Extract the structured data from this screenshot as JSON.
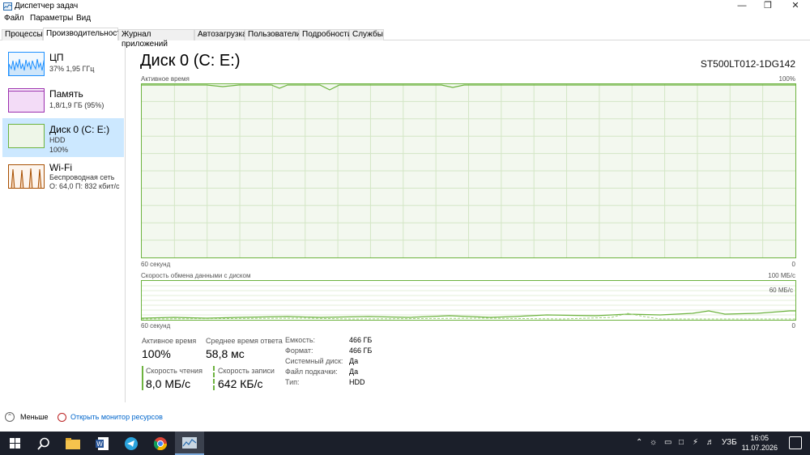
{
  "window": {
    "title": "Диспетчер задач"
  },
  "menu": [
    "Файл",
    "Параметры",
    "Вид"
  ],
  "tabs": [
    "Процессы",
    "Производительность",
    "Журнал приложений",
    "Автозагрузка",
    "Пользователи",
    "Подробности",
    "Службы"
  ],
  "active_tab": 1,
  "resources": [
    {
      "name": "ЦП",
      "line1": "37% 1,95 ГГц",
      "line2": ""
    },
    {
      "name": "Память",
      "line1": "1,8/1,9 ГБ (95%)",
      "line2": ""
    },
    {
      "name": "Диск 0 (C: E:)",
      "line1": "HDD",
      "line2": "100%"
    },
    {
      "name": "Wi-Fi",
      "line1": "Беспроводная сеть",
      "line2": "О: 64,0  П: 832 кбит/с"
    }
  ],
  "main": {
    "title": "Диск 0 (C: E:)",
    "model": "ST500LT012-1DG142",
    "chart1": {
      "label": "Активное время",
      "max_label": "100%",
      "time_label": "60 секунд",
      "min_label": "0"
    },
    "chart2": {
      "label": "Скорость обмена данными с диском",
      "max_label": "100 МБ/с",
      "mid_label": "60 МБ/с",
      "time_label": "60 секунд",
      "min_label": "0"
    },
    "stats": {
      "active_time_label": "Активное время",
      "active_time_value": "100%",
      "avg_response_label": "Среднее время ответа",
      "avg_response_value": "58,8 мс",
      "read_label": "Скорость чтения",
      "read_value": "8,0 МБ/с",
      "write_label": "Скорость записи",
      "write_value": "642 КБ/с"
    },
    "properties": [
      {
        "label": "Емкость:",
        "value": "466 ГБ"
      },
      {
        "label": "Формат:",
        "value": "466 ГБ"
      },
      {
        "label": "Системный диск:",
        "value": "Да"
      },
      {
        "label": "Файл подкачки:",
        "value": "Да"
      },
      {
        "label": "Тип:",
        "value": "HDD"
      }
    ]
  },
  "bottom": {
    "fewer": "Меньше",
    "resmon": "Открыть монитор ресурсов"
  },
  "taskbar": {
    "lang": "УЗБ",
    "time": "16:05",
    "date": "11.07.2026"
  },
  "colors": {
    "accent_green": "#6db33f",
    "cpu_blue": "#1e90ff",
    "mem_purple": "#9b2fae",
    "wifi_orange": "#a74f01",
    "selected": "#cce8ff"
  }
}
